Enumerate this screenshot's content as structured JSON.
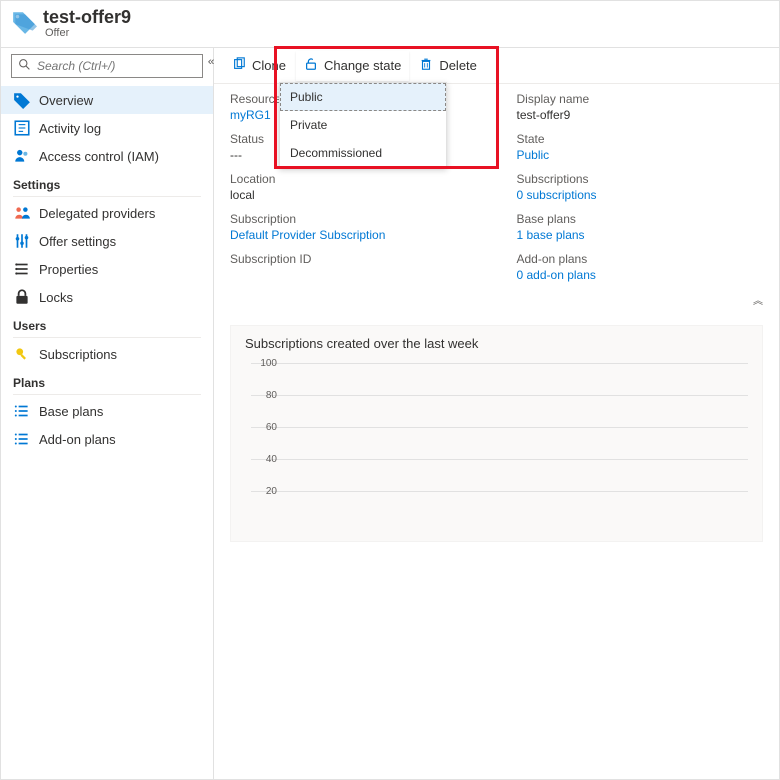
{
  "header": {
    "title": "test-offer9",
    "subtitle": "Offer"
  },
  "search": {
    "placeholder": "Search (Ctrl+/)"
  },
  "sidebar": {
    "core": [
      {
        "label": "Overview"
      },
      {
        "label": "Activity log"
      },
      {
        "label": "Access control (IAM)"
      }
    ],
    "sections": [
      {
        "heading": "Settings",
        "items": [
          {
            "label": "Delegated providers"
          },
          {
            "label": "Offer settings"
          },
          {
            "label": "Properties"
          },
          {
            "label": "Locks"
          }
        ]
      },
      {
        "heading": "Users",
        "items": [
          {
            "label": "Subscriptions"
          }
        ]
      },
      {
        "heading": "Plans",
        "items": [
          {
            "label": "Base plans"
          },
          {
            "label": "Add-on plans"
          }
        ]
      }
    ]
  },
  "toolbar": {
    "clone": "Clone",
    "change_state": "Change state",
    "delete": "Delete"
  },
  "state_dropdown": {
    "items": [
      "Public",
      "Private",
      "Decommissioned"
    ],
    "selected_index": 0
  },
  "details": {
    "left": [
      {
        "label": "Resource group",
        "value": "myRG1",
        "link": true
      },
      {
        "label": "Status",
        "value": "---"
      },
      {
        "label": "Location",
        "value": "local"
      },
      {
        "label": "Subscription",
        "value": "Default Provider Subscription",
        "link": true
      },
      {
        "label": "Subscription ID",
        "value": ""
      }
    ],
    "right": [
      {
        "label": "Display name",
        "value": "test-offer9"
      },
      {
        "label": "State",
        "value": "Public",
        "link": true
      },
      {
        "label": "Subscriptions",
        "value": "0 subscriptions",
        "link": true
      },
      {
        "label": "Base plans",
        "value": "1 base plans",
        "link": true
      },
      {
        "label": "Add-on plans",
        "value": "0 add-on plans",
        "link": true
      }
    ]
  },
  "chart_data": {
    "type": "line",
    "title": "Subscriptions created over the last week",
    "y_ticks": [
      100,
      80,
      60,
      40,
      20
    ],
    "ylim": [
      0,
      100
    ],
    "series": [
      {
        "name": "Subscriptions",
        "values": []
      }
    ]
  }
}
